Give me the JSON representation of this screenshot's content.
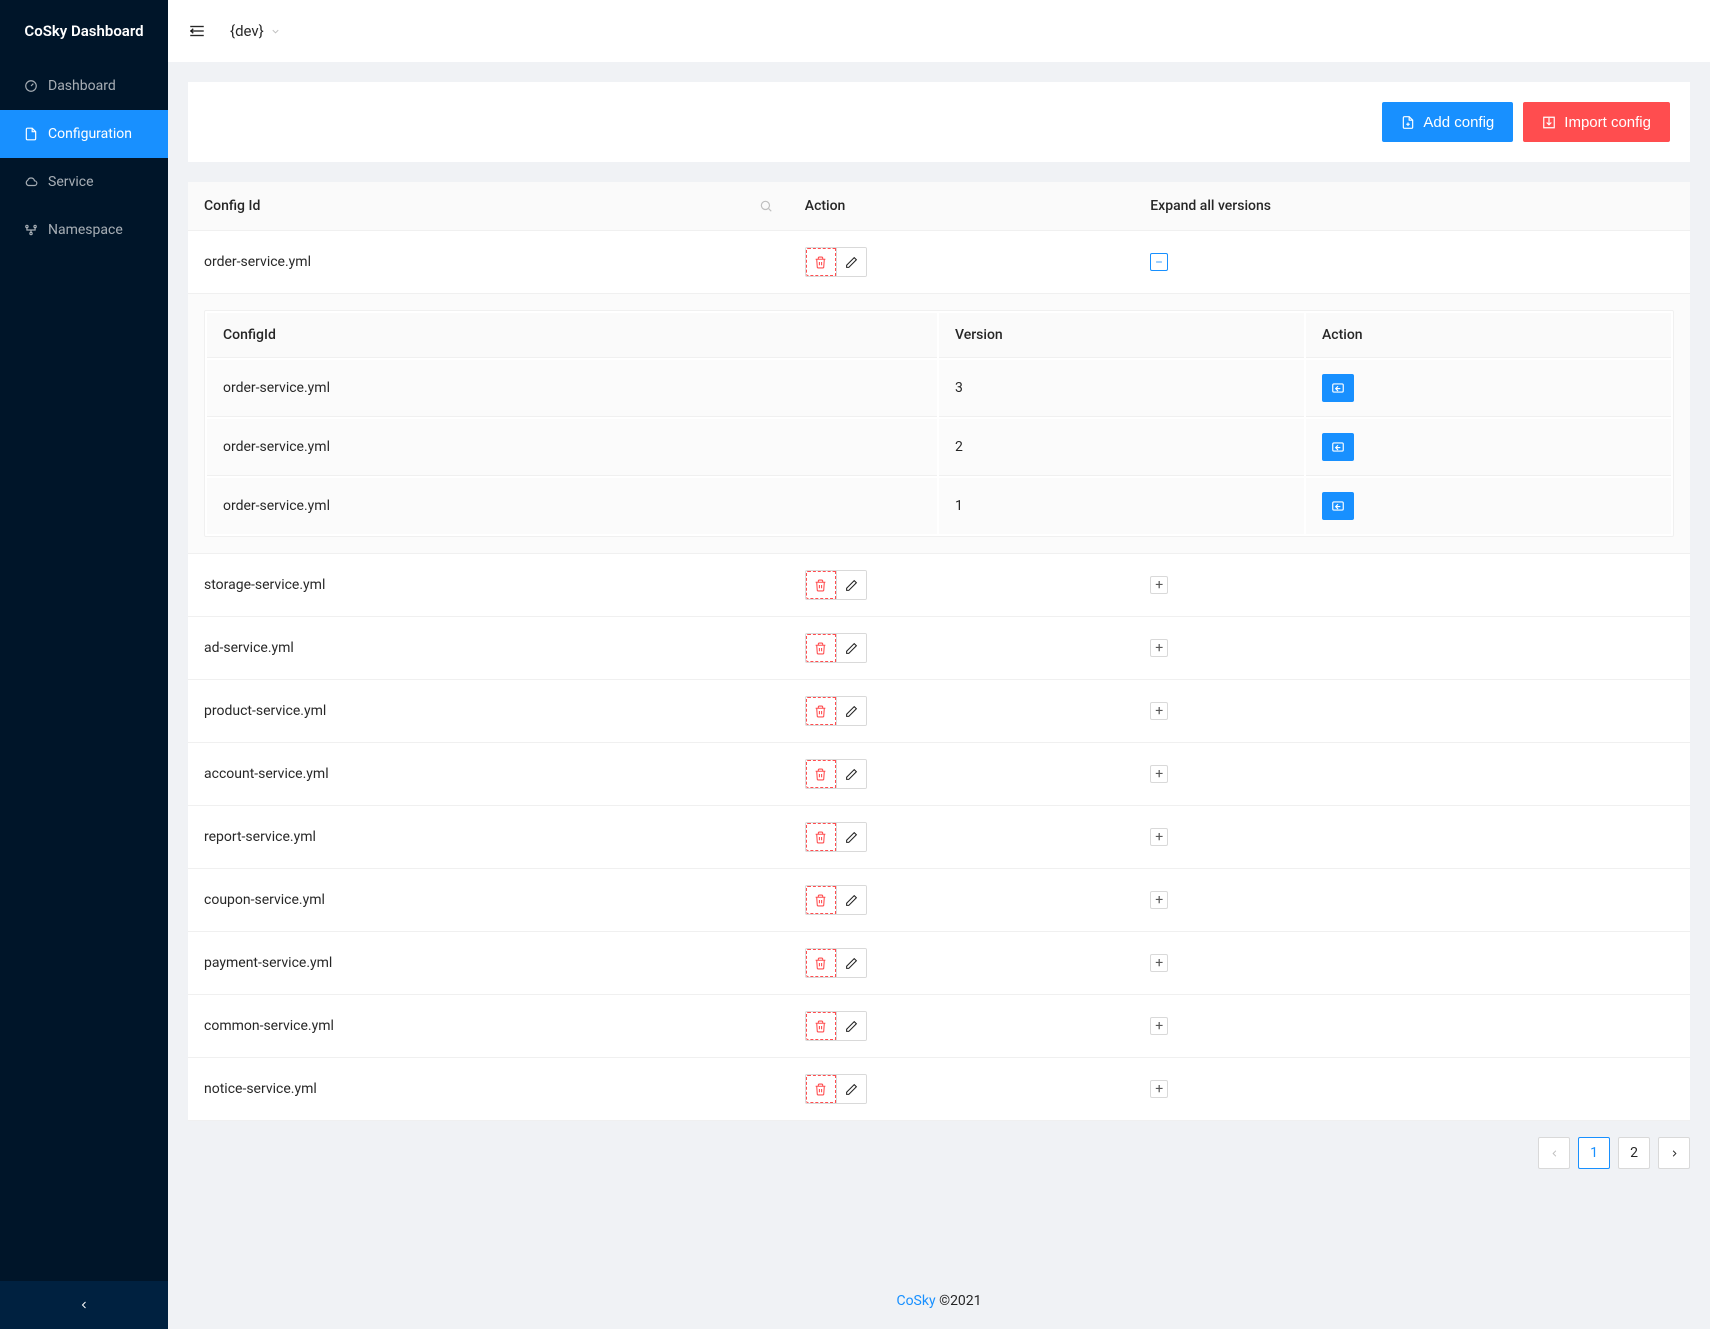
{
  "app": {
    "title": "CoSky Dashboard"
  },
  "sidebar": {
    "items": [
      {
        "key": "dashboard",
        "label": "Dashboard",
        "icon": "dashboard-icon"
      },
      {
        "key": "configuration",
        "label": "Configuration",
        "icon": "file-icon",
        "selected": true
      },
      {
        "key": "service",
        "label": "Service",
        "icon": "cloud-icon"
      },
      {
        "key": "namespace",
        "label": "Namespace",
        "icon": "nodes-icon"
      }
    ]
  },
  "header": {
    "namespace": "{dev}"
  },
  "toolbar": {
    "add_label": "Add config",
    "import_label": "Import config"
  },
  "table": {
    "columns": {
      "config_id": "Config Id",
      "action": "Action",
      "expand": "Expand all versions"
    },
    "rows": [
      {
        "config_id": "order-service.yml",
        "expanded": true
      },
      {
        "config_id": "storage-service.yml",
        "expanded": false
      },
      {
        "config_id": "ad-service.yml",
        "expanded": false
      },
      {
        "config_id": "product-service.yml",
        "expanded": false
      },
      {
        "config_id": "account-service.yml",
        "expanded": false
      },
      {
        "config_id": "report-service.yml",
        "expanded": false
      },
      {
        "config_id": "coupon-service.yml",
        "expanded": false
      },
      {
        "config_id": "payment-service.yml",
        "expanded": false
      },
      {
        "config_id": "common-service.yml",
        "expanded": false
      },
      {
        "config_id": "notice-service.yml",
        "expanded": false
      }
    ],
    "inner_columns": {
      "config_id": "ConfigId",
      "version": "Version",
      "action": "Action"
    },
    "expanded_versions": {
      "order-service.yml": [
        {
          "config_id": "order-service.yml",
          "version": "3"
        },
        {
          "config_id": "order-service.yml",
          "version": "2"
        },
        {
          "config_id": "order-service.yml",
          "version": "1"
        }
      ]
    }
  },
  "pagination": {
    "pages": [
      "1",
      "2"
    ],
    "current": "1"
  },
  "footer": {
    "link_text": "CoSky",
    "rest": " ©2021"
  }
}
